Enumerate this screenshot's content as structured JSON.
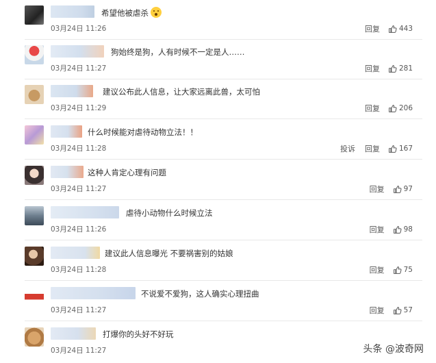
{
  "labels": {
    "reply": "回复",
    "report": "投诉"
  },
  "watermark": "头条 @波奇网",
  "comments": [
    {
      "text": "希望他被虐杀",
      "time": "03月24日 11:26",
      "likes": "443",
      "emoji": true,
      "report": false
    },
    {
      "text": "狗始终是狗，人有时候不一定是人……",
      "time": "03月24日 11:27",
      "likes": "281",
      "emoji": false,
      "report": false
    },
    {
      "text": "建议公布此人信息，让大家远离此兽，太可怕",
      "time": "03月24日 11:29",
      "likes": "206",
      "emoji": false,
      "report": false
    },
    {
      "text": "什么时候能对虐待动物立法！！",
      "time": "03月24日 11:28",
      "likes": "167",
      "emoji": false,
      "report": true
    },
    {
      "text": "这种人肯定心理有问题",
      "time": "03月24日 11:27",
      "likes": "97",
      "emoji": false,
      "report": false
    },
    {
      "text": "虐待小动物什么时候立法",
      "time": "03月24日 11:26",
      "likes": "98",
      "emoji": false,
      "report": false
    },
    {
      "text": "建议此人信息曝光 不要祸害别的姑娘",
      "time": "03月24日 11:28",
      "likes": "75",
      "emoji": false,
      "report": false
    },
    {
      "text": "不说爱不爱狗，这人确实心理扭曲",
      "time": "03月24日 11:27",
      "likes": "57",
      "emoji": false,
      "report": false
    },
    {
      "text": "打爆你的头好不好玩",
      "time": "03月24日 11:27",
      "likes": "",
      "emoji": false,
      "report": false
    }
  ]
}
